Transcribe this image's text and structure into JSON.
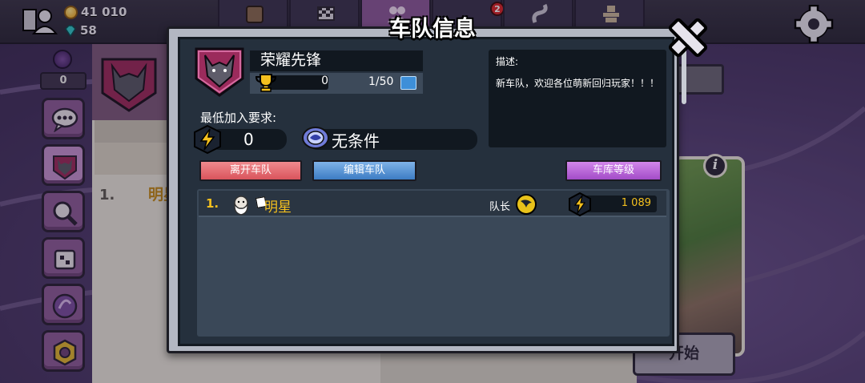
{
  "topbar": {
    "coins": "41 010",
    "gems": "58",
    "notification_count": "2",
    "tabs": [
      {
        "icon": "paper-bag-icon",
        "active": false
      },
      {
        "icon": "checkered-flag-icon",
        "active": false
      },
      {
        "icon": "crew-icon",
        "active": true
      },
      {
        "icon": "road-icon",
        "active": false
      },
      {
        "icon": "trophy-stack-icon",
        "active": false
      }
    ]
  },
  "left_strip": {
    "count": "0",
    "buttons": [
      "chat-bubble-icon",
      "wolf-emblem-icon",
      "magnifier-icon",
      "puzzle-icon",
      "orb-icon",
      "nut-icon"
    ]
  },
  "background": {
    "rank": "1.",
    "name": "明星",
    "start_button": "开始"
  },
  "modal": {
    "title": "车队信息",
    "crew_name": "荣耀先锋",
    "trophies": "0",
    "members": "1/50",
    "min_req_label": "最低加入要求:",
    "min_req_value": "0",
    "min_req_league": "无条件",
    "description_label": "描述:",
    "description": "新车队，欢迎各位萌新回归玩家！！！",
    "buttons": {
      "leave": "离开车队",
      "edit": "编辑车队",
      "garage": "车库等级"
    },
    "members_list": [
      {
        "rank": "1.",
        "name": "明星",
        "role": "队长",
        "score": "1 089"
      }
    ]
  },
  "colors": {
    "accent_gold": "#f4c01e",
    "leave": "#d9545c",
    "edit": "#3c7cc4",
    "garage": "#a34cc8",
    "panel_dark": "#25303d"
  }
}
